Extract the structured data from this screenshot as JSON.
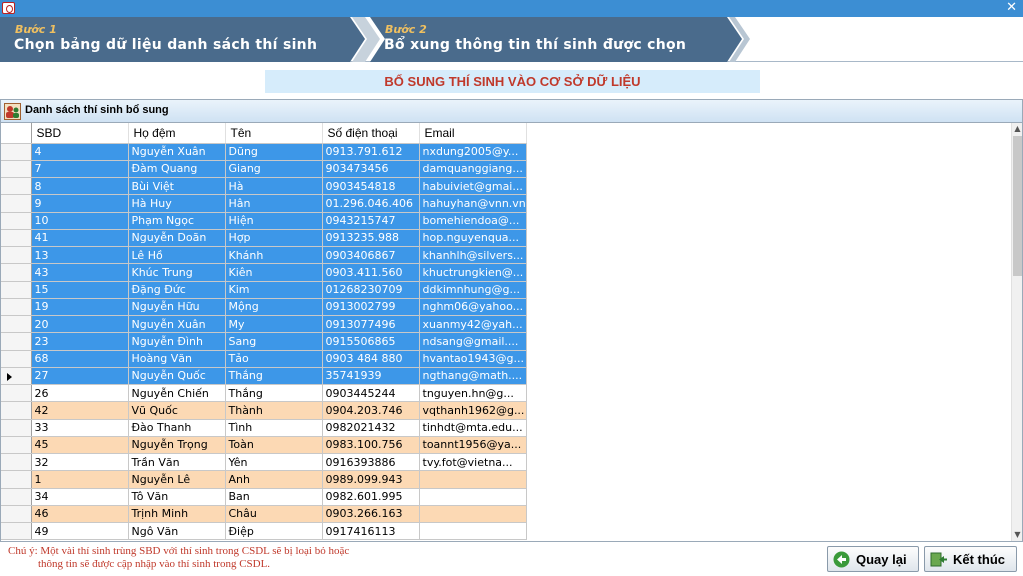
{
  "window": {
    "close_symbol": "✕"
  },
  "steps": [
    {
      "number": "Bước 1",
      "text": "Chọn bảng dữ liệu danh sách thí sinh"
    },
    {
      "number": "Bước 2",
      "text": "Bổ xung thông tin thí sinh được chọn"
    }
  ],
  "banner": "BỔ SUNG THÍ SINH VÀO CƠ SỞ DỮ LIỆU",
  "panel": {
    "title": "Danh sách thí sinh bổ sung",
    "icon": "users-icon"
  },
  "grid": {
    "columns": [
      "SBD",
      "Họ đệm",
      "Tên",
      "Số điện thoại",
      "Email"
    ],
    "rows": [
      {
        "sbd": "4",
        "ho": "Nguyễn Xuân",
        "ten": "Dũng",
        "phone": "0913.791.612",
        "email": "nxdung2005@y...",
        "state": "selected"
      },
      {
        "sbd": "7",
        "ho": "Đàm Quang",
        "ten": "Giang",
        "phone": "903473456",
        "email": "damquanggiang...",
        "state": "selected"
      },
      {
        "sbd": "8",
        "ho": "Bùi Việt",
        "ten": "Hà",
        "phone": "0903454818",
        "email": "habuiviet@gmai...",
        "state": "selected"
      },
      {
        "sbd": "9",
        "ho": "Hà Huy",
        "ten": "Hân",
        "phone": "01.296.046.406",
        "email": "hahuyhan@vnn.vn",
        "state": "selected"
      },
      {
        "sbd": "10",
        "ho": "Phạm Ngọc",
        "ten": "Hiện",
        "phone": "0943215747",
        "email": "bomehiendoa@...",
        "state": "selected"
      },
      {
        "sbd": "41",
        "ho": "Nguyễn Doãn",
        "ten": "Hợp",
        "phone": "0913235.988",
        "email": "hop.nguyenqua...",
        "state": "selected"
      },
      {
        "sbd": "13",
        "ho": "Lê Hồ",
        "ten": "Khánh",
        "phone": "0903406867",
        "email": "khanhlh@silvers...",
        "state": "selected"
      },
      {
        "sbd": "43",
        "ho": "Khúc Trung",
        "ten": "Kiên",
        "phone": "0903.411.560",
        "email": "khuctrungkien@...",
        "state": "selected"
      },
      {
        "sbd": "15",
        "ho": "Đặng Đức",
        "ten": "Kim",
        "phone": "01268230709",
        "email": "ddkimnhung@g...",
        "state": "selected"
      },
      {
        "sbd": "19",
        "ho": "Nguyễn Hữu",
        "ten": "Mộng",
        "phone": "0913002799",
        "email": "nghm06@yahoo...",
        "state": "selected"
      },
      {
        "sbd": "20",
        "ho": "Nguyễn Xuân",
        "ten": "My",
        "phone": "0913077496",
        "email": "xuanmy42@yah...",
        "state": "selected"
      },
      {
        "sbd": "23",
        "ho": "Nguyễn Đình",
        "ten": "Sang",
        "phone": "0915506865",
        "email": "ndsang@gmail....",
        "state": "selected"
      },
      {
        "sbd": "68",
        "ho": "Hoàng Văn",
        "ten": "Tảo",
        "phone": "0903 484 880",
        "email": "hvantao1943@g...",
        "state": "selected"
      },
      {
        "sbd": "27",
        "ho": "Nguyễn Quốc",
        "ten": "Thắng",
        "phone": "35741939",
        "email": "ngthang@math....",
        "state": "current"
      },
      {
        "sbd": "26",
        "ho": "Nguyễn Chiến",
        "ten": "Thắng",
        "phone": "0903445244",
        "email": "tnguyen.hn@g...",
        "state": "normal"
      },
      {
        "sbd": "42",
        "ho": "Vũ Quốc",
        "ten": "Thành",
        "phone": "0904.203.746",
        "email": "vqthanh1962@g...",
        "state": "alt"
      },
      {
        "sbd": "33",
        "ho": "Đào Thanh",
        "ten": "Tình",
        "phone": "0982021432",
        "email": "tinhdt@mta.edu...",
        "state": "normal"
      },
      {
        "sbd": "45",
        "ho": "Nguyễn Trọng",
        "ten": "Toàn",
        "phone": "0983.100.756",
        "email": "toannt1956@ya...",
        "state": "alt"
      },
      {
        "sbd": "32",
        "ho": "Trần Văn",
        "ten": "Yên",
        "phone": "0916393886",
        "email": "tvy.fot@vietna...",
        "state": "normal"
      },
      {
        "sbd": "1",
        "ho": "Nguyễn Lê",
        "ten": "Anh",
        "phone": "0989.099.943",
        "email": "",
        "state": "alt"
      },
      {
        "sbd": "34",
        "ho": "Tô Văn",
        "ten": "Ban",
        "phone": "0982.601.995",
        "email": "",
        "state": "normal"
      },
      {
        "sbd": "46",
        "ho": "Trịnh Minh",
        "ten": "Châu",
        "phone": "0903.266.163",
        "email": "",
        "state": "alt"
      },
      {
        "sbd": "49",
        "ho": "Ngô Văn",
        "ten": "Điệp",
        "phone": "0917416113",
        "email": "",
        "state": "normal"
      }
    ]
  },
  "note": {
    "line1": "Chú ý: Một vài thí sinh trùng SBD với thí sinh trong CSDL sẽ bị loại bỏ hoặc",
    "line2": "thông tin sẽ được cập nhập vào thí sinh trong CSDL."
  },
  "buttons": {
    "back": "Quay lại",
    "finish": "Kết thúc"
  },
  "colors": {
    "selected_row": "#3d97e8",
    "alt_row": "#fcd9b4",
    "step_bar": "#4a6b8c",
    "accent_red": "#c0392b"
  }
}
